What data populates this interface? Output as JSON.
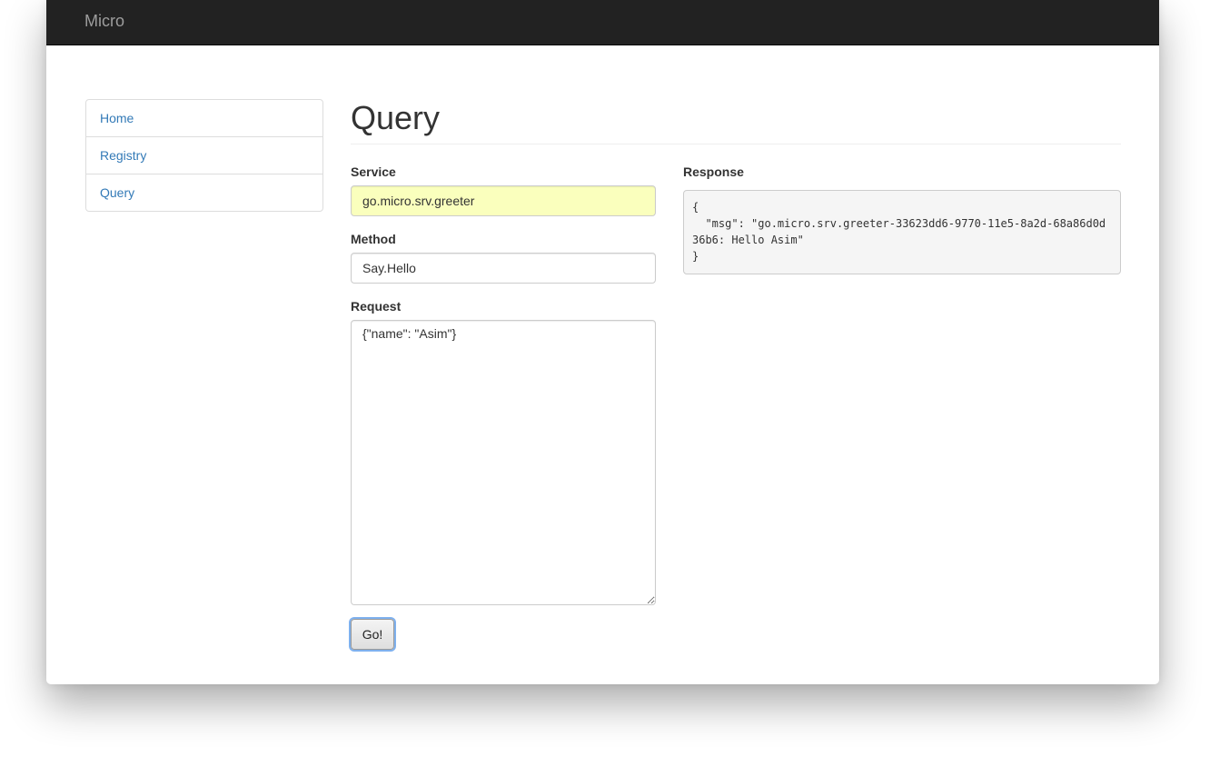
{
  "navbar": {
    "brand": "Micro"
  },
  "sidebar": {
    "items": [
      {
        "label": "Home"
      },
      {
        "label": "Registry"
      },
      {
        "label": "Query"
      }
    ]
  },
  "page": {
    "title": "Query"
  },
  "form": {
    "service": {
      "label": "Service",
      "value": "go.micro.srv.greeter"
    },
    "method": {
      "label": "Method",
      "value": "Say.Hello"
    },
    "request": {
      "label": "Request",
      "value": "{\"name\": \"Asim\"}"
    },
    "submit_label": "Go!"
  },
  "response": {
    "label": "Response",
    "body": "{\n  \"msg\": \"go.micro.srv.greeter-33623dd6-9770-11e5-8a2d-68a86d0d36b6: Hello Asim\"\n}"
  },
  "colors": {
    "navbar_bg": "#222222",
    "link": "#337ab7",
    "autofill_bg": "#faffbd"
  }
}
